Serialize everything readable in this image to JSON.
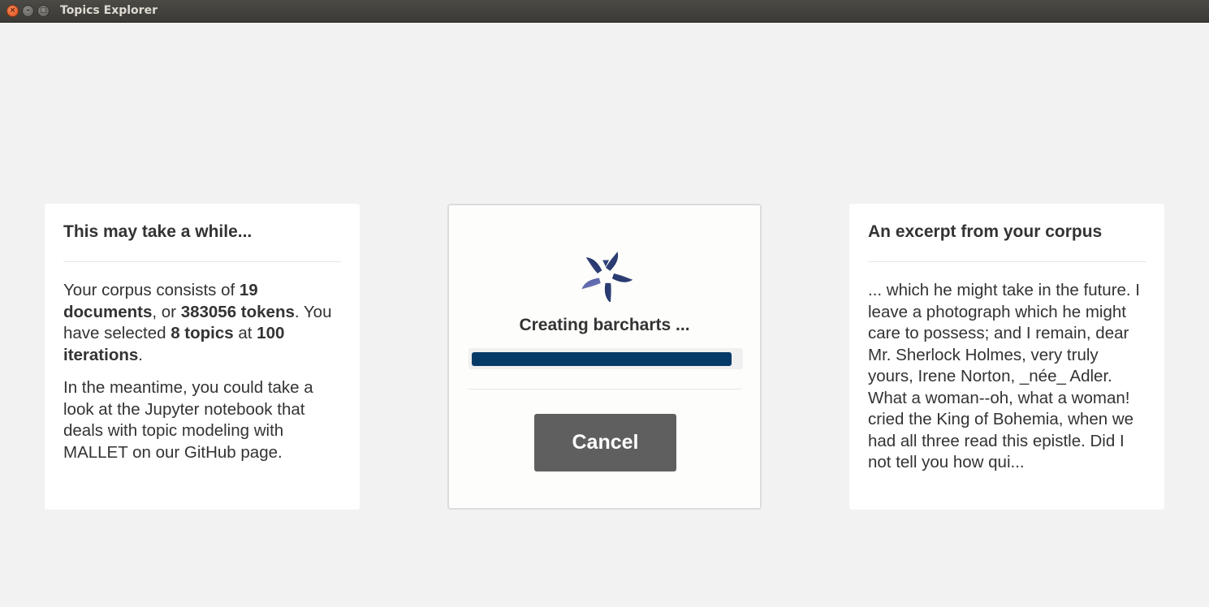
{
  "window": {
    "title": "Topics Explorer"
  },
  "left_card": {
    "heading": "This may take a while...",
    "p1": [
      {
        "t": "Your corpus consists of ",
        "b": false
      },
      {
        "t": "19 documents",
        "b": true
      },
      {
        "t": ", or ",
        "b": false
      },
      {
        "t": "383056 tokens",
        "b": true
      },
      {
        "t": ". You have selected ",
        "b": false
      },
      {
        "t": "8 topics",
        "b": true
      },
      {
        "t": " at ",
        "b": false
      },
      {
        "t": "100 iterations",
        "b": true
      },
      {
        "t": ".",
        "b": false
      }
    ],
    "p2": "In the meantime, you could take a look at the Jupyter notebook that deals with topic modeling with MALLET on our GitHub page."
  },
  "progress_card": {
    "status": "Creating barcharts ...",
    "progress": 0.97,
    "cancel_label": "Cancel",
    "logo_icon": "flower-logo-icon",
    "accent_color": "#053a68"
  },
  "right_card": {
    "heading": "An excerpt from your corpus",
    "excerpt": "... which he might take in the future. I leave a photograph which he might care to possess; and I remain, dear Mr. Sherlock Holmes, very truly yours, Irene Norton, _née_ Adler. What a woman--oh, what a woman! cried the King of Bohemia, when we had all three read this epistle. Did I not tell you how qui..."
  }
}
